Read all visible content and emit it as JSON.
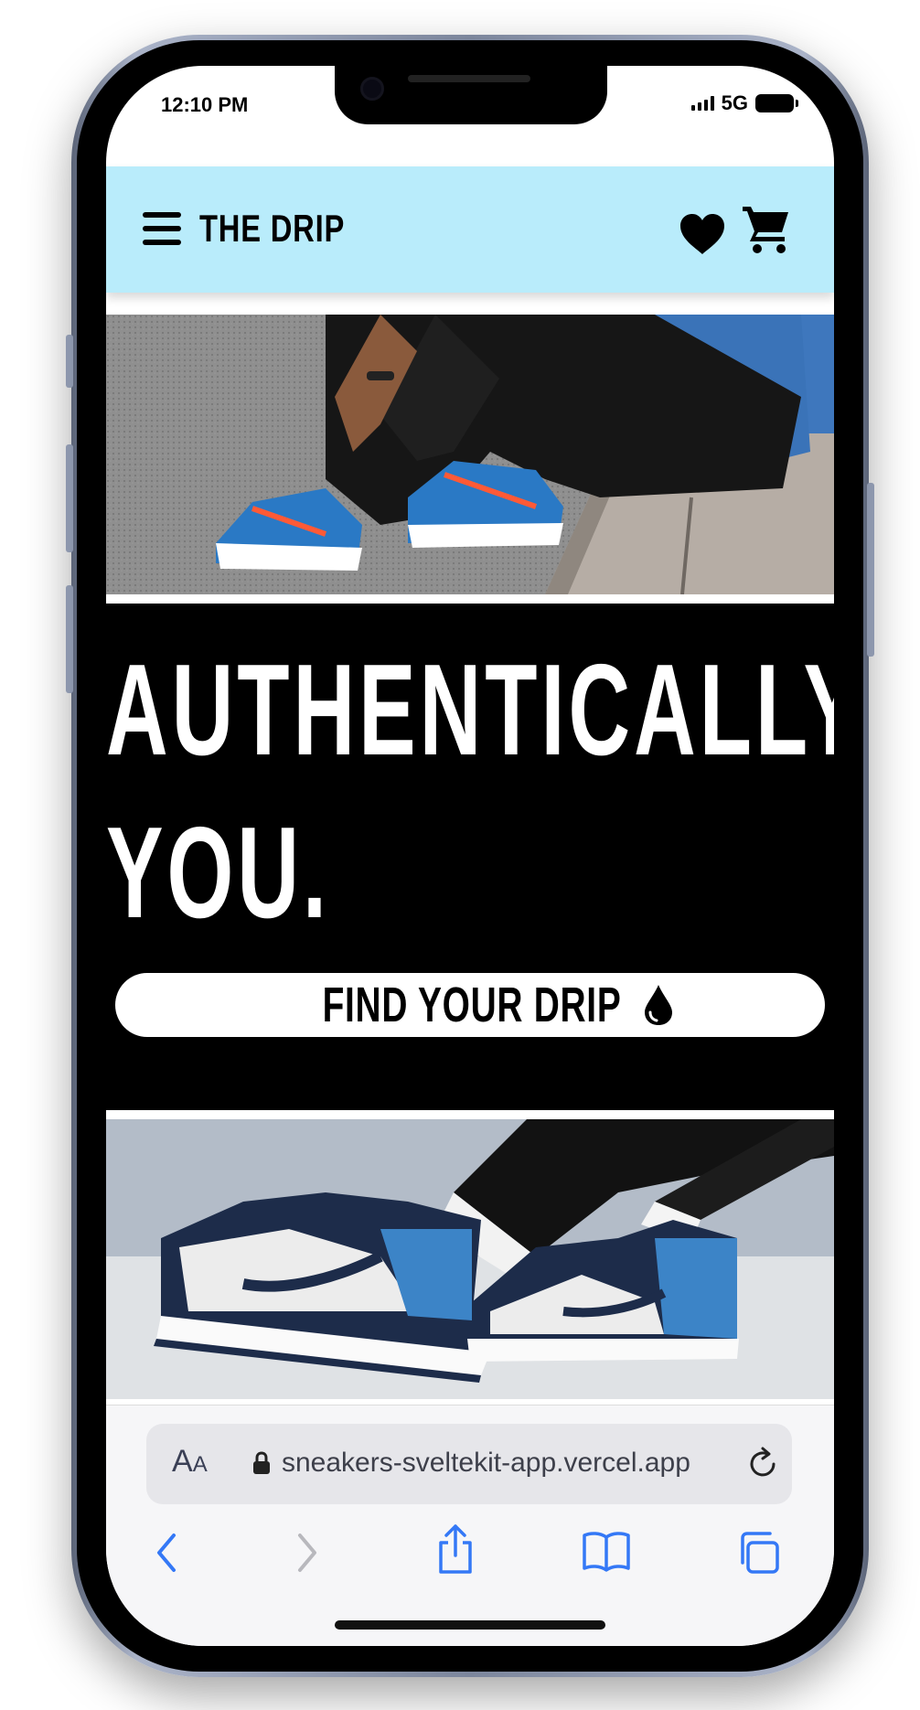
{
  "status_bar": {
    "time": "12:10 PM",
    "network": "5G"
  },
  "header": {
    "brand": "THE DRIP"
  },
  "hero": {
    "line1": "AUTHENTICALLY.",
    "line2": "YOU.",
    "cta_label": "FIND YOUR DRIP"
  },
  "browser": {
    "text_size_label_big": "A",
    "text_size_label_small": "A",
    "url": "sneakers-sveltekit-app.vercel.app"
  },
  "colors": {
    "header_bg": "#b9ecfb",
    "hero_bg": "#000000",
    "safari_accent": "#3478f6"
  }
}
